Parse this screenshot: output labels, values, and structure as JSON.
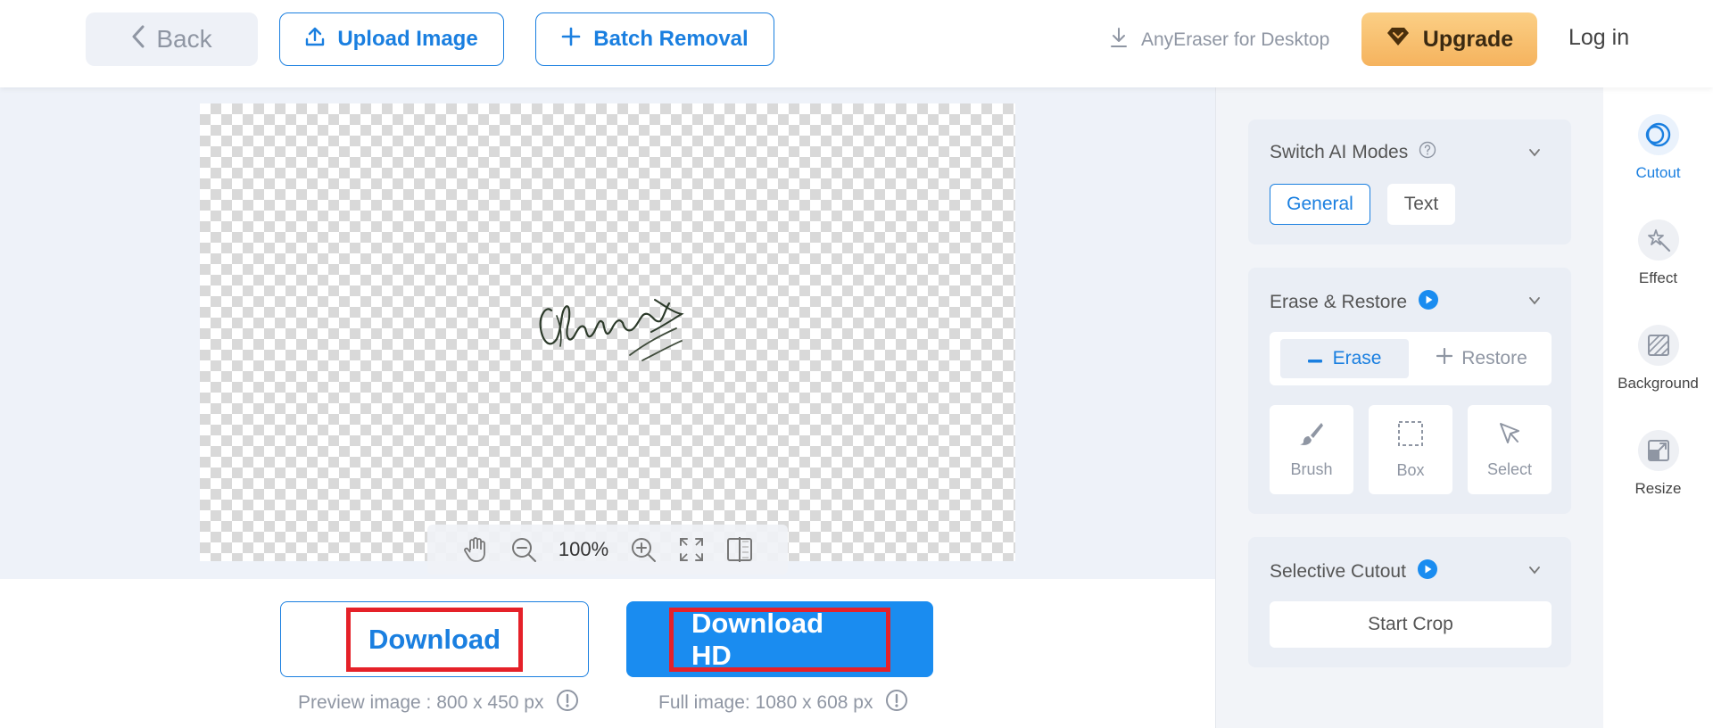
{
  "header": {
    "back_label": "Back",
    "upload_label": "Upload Image",
    "batch_label": "Batch Removal",
    "desktop_label": "AnyEraser for Desktop",
    "upgrade_label": "Upgrade",
    "login_label": "Log in"
  },
  "canvas": {
    "zoom_level": "100%"
  },
  "download": {
    "download_label": "Download",
    "download_hd_label": "Download HD",
    "preview_info": "Preview image : 800 x 450 px",
    "full_info": "Full image: 1080 x 608 px"
  },
  "panel": {
    "ai_modes": {
      "title": "Switch AI Modes",
      "options": [
        "General",
        "Text"
      ],
      "selected": "General"
    },
    "erase_restore": {
      "title": "Erase & Restore",
      "erase_label": "Erase",
      "restore_label": "Restore",
      "tools": [
        "Brush",
        "Box",
        "Select"
      ]
    },
    "selective_cutout": {
      "title": "Selective Cutout",
      "start_crop_label": "Start Crop"
    }
  },
  "rail": {
    "items": [
      "Cutout",
      "Effect",
      "Background",
      "Resize"
    ],
    "active": "Cutout"
  },
  "colors": {
    "accent": "#1a7fe0",
    "upgrade": "#f5b35e",
    "highlight": "#e52129"
  }
}
